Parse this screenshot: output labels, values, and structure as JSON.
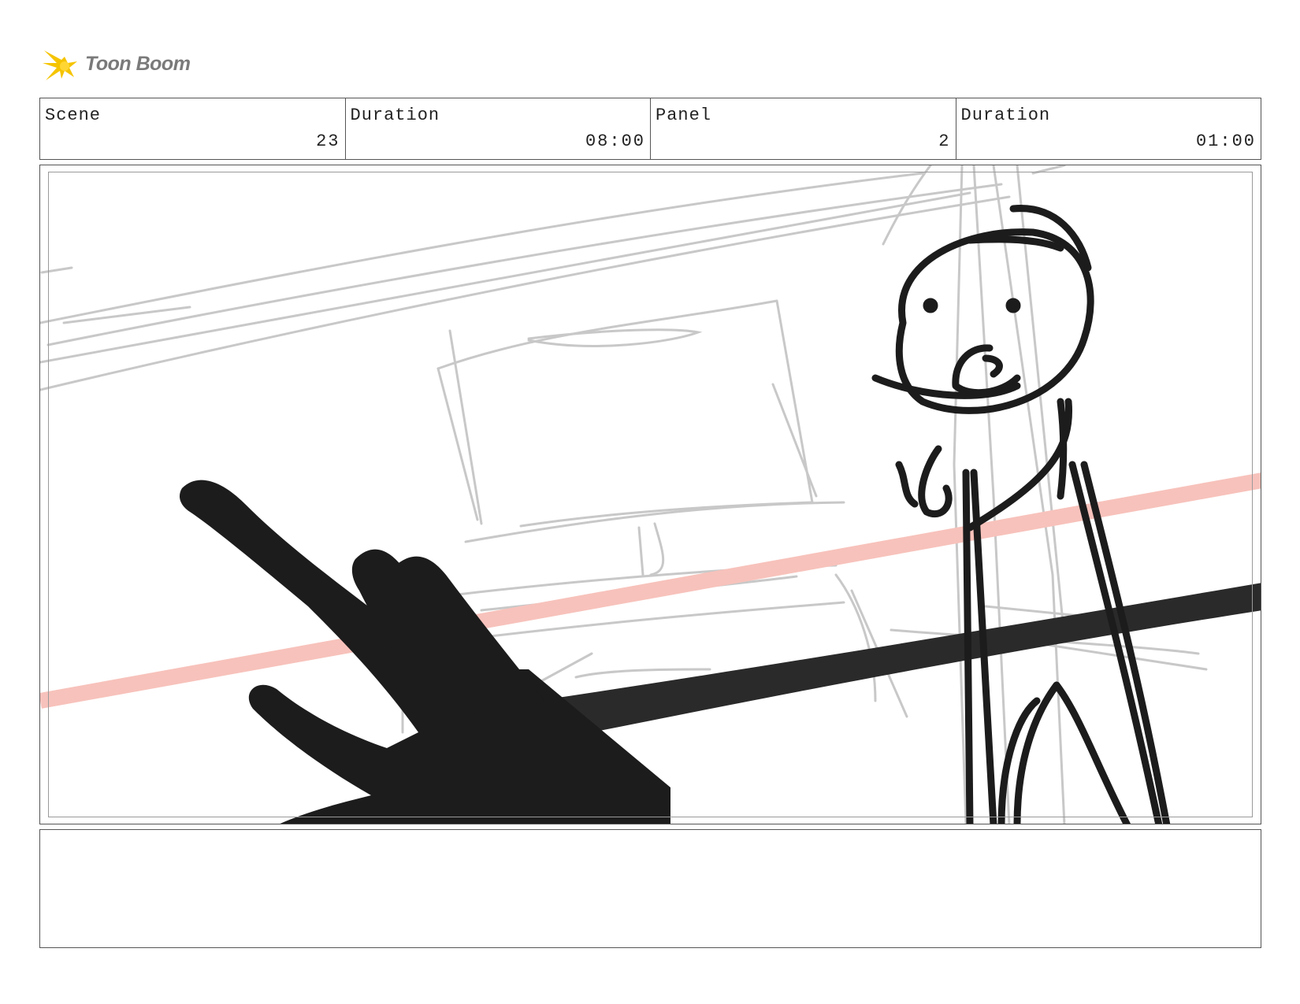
{
  "brand": {
    "logo_text": "Toon Boom",
    "logo_color": "#f5c400"
  },
  "info": {
    "scene_label": "Scene",
    "scene_value": "23",
    "scene_duration_label": "Duration",
    "scene_duration_value": "08:00",
    "panel_label": "Panel",
    "panel_value": "2",
    "panel_duration_label": "Duration",
    "panel_duration_value": "01:00"
  },
  "notes": {
    "text": ""
  },
  "colors": {
    "border": "#555555",
    "sketch_rough": "#c8c8c8",
    "sketch_ink": "#1c1c1c",
    "guide_line": "#f7c2bb"
  }
}
